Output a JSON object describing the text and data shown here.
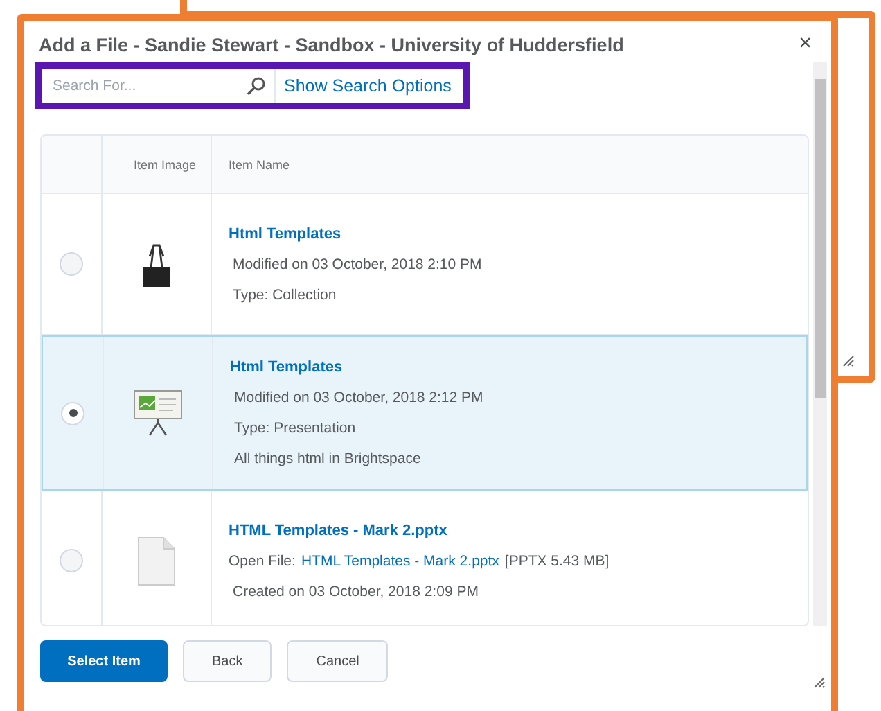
{
  "dialog": {
    "title": "Add a File - Sandie Stewart - Sandbox - University of Huddersfield",
    "close": "×"
  },
  "search": {
    "placeholder": "Search For...",
    "options_link": "Show Search Options"
  },
  "table": {
    "columns": [
      "Item Image",
      "Item Name"
    ],
    "rows": [
      {
        "selected": false,
        "kind": "binder",
        "title": "Html Templates",
        "lines": [
          {
            "kind": "text",
            "text": "Modified on 03 October, 2018 2:10 PM"
          },
          {
            "kind": "text",
            "text": "Type: Collection"
          }
        ]
      },
      {
        "selected": true,
        "kind": "presentation",
        "title": "Html Templates",
        "lines": [
          {
            "kind": "text",
            "text": "Modified on 03 October, 2018 2:12 PM"
          },
          {
            "kind": "text",
            "text": "Type: Presentation"
          },
          {
            "kind": "text",
            "text": "All things html in Brightspace"
          }
        ]
      },
      {
        "selected": false,
        "kind": "file",
        "title": "HTML Templates - Mark 2.pptx",
        "lines": [
          {
            "kind": "file",
            "label": "Open File:",
            "link": "HTML Templates - Mark 2.pptx",
            "info": "[PPTX  5.43 MB]"
          },
          {
            "kind": "text",
            "text": "Created on 03 October, 2018 2:09 PM"
          }
        ]
      }
    ]
  },
  "buttons": [
    {
      "label": "Select Item",
      "primary": true
    },
    {
      "label": "Back",
      "primary": false
    },
    {
      "label": "Cancel",
      "primary": false
    }
  ]
}
